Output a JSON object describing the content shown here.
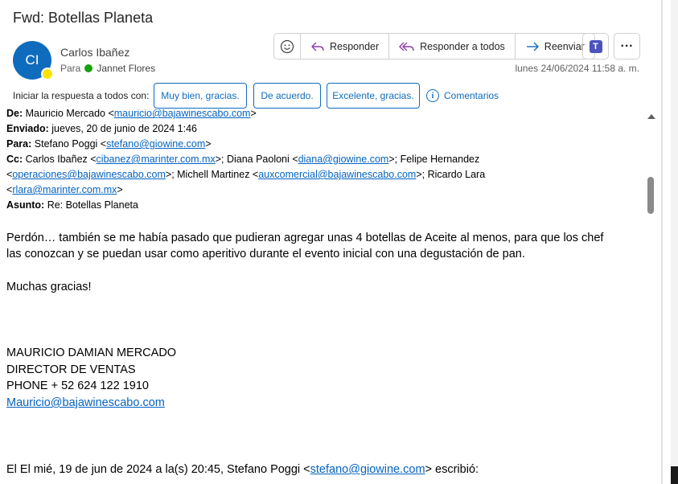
{
  "message": {
    "subject": "Fwd: Botellas Planeta",
    "sender_initials": "CI",
    "sender_name": "Carlos Ibañez",
    "to_label": "Para",
    "to_name": "Jannet Flores",
    "date": "lunes 24/06/2024 11:58 a. m."
  },
  "toolbar": {
    "emoji_icon": "smiley-icon",
    "reply_label": "Responder",
    "reply_all_label": "Responder a todos",
    "forward_label": "Reenviar",
    "teams_icon": "teams-icon",
    "more_icon": "more-icon"
  },
  "quick_replies": {
    "label": "Iniciar la respuesta a todos con:",
    "options": [
      "Muy bien, gracias.",
      "De acuerdo.",
      "Excelente, gracias."
    ],
    "comments_label": "Comentarios"
  },
  "forwarded": {
    "from_label": "De:",
    "from_name": "Mauricio Mercado <",
    "from_email": "mauricio@bajawinescabo.com",
    "from_close": ">",
    "sent_label": "Enviado:",
    "sent_value": "jueves, 20 de junio de 2024 1:46",
    "to_label": "Para:",
    "to_name": "Stefano Poggi <",
    "to_email": "stefano@giowine.com",
    "to_close": ">",
    "cc_label": "Cc:",
    "cc_1_name": "Carlos Ibañez <",
    "cc_1_email": "cibanez@marinter.com.mx",
    "cc_2_name": ">; Diana Paoloni <",
    "cc_2_email": "diana@giowine.com",
    "cc_3_name": ">; Felipe Hernandez",
    "cc_3_open": "<",
    "cc_3_email": "operaciones@bajawinescabo.com",
    "cc_4_name": ">; Michell Martinez <",
    "cc_4_email": "auxcomercial@bajawinescabo.com",
    "cc_5_name": ">; Ricardo Lara",
    "cc_5_open": "<",
    "cc_5_email": "rlara@marinter.com.mx",
    "cc_5_close": ">",
    "subject_label": "Asunto:",
    "subject_value": "Re: Botellas Planeta"
  },
  "body": {
    "line1": "Perdón… también se me había pasado que pudieran agregar unas 4 botellas de Aceite al menos, para que los chef",
    "line2": "las conozcan y se puedan usar como aperitivo durante el evento inicial con una degustación de pan.",
    "thanks": "Muchas gracias!",
    "sig_name": "MAURICIO DAMIAN MERCADO",
    "sig_title": "DIRECTOR DE VENTAS",
    "sig_phone": "PHONE + 52 624 122 1910",
    "sig_email": "Mauricio@bajawinescabo.com",
    "quote_prefix": "El El mié, 19 de jun de 2024 a la(s) 20:45, Stefano Poggi <",
    "quote_email": "stefano@giowine.com",
    "quote_suffix": "> escribió:"
  },
  "colors": {
    "accent": "#0f6cbd",
    "link": "#0563c1",
    "presence": "#fde300",
    "online": "#13a10e"
  }
}
